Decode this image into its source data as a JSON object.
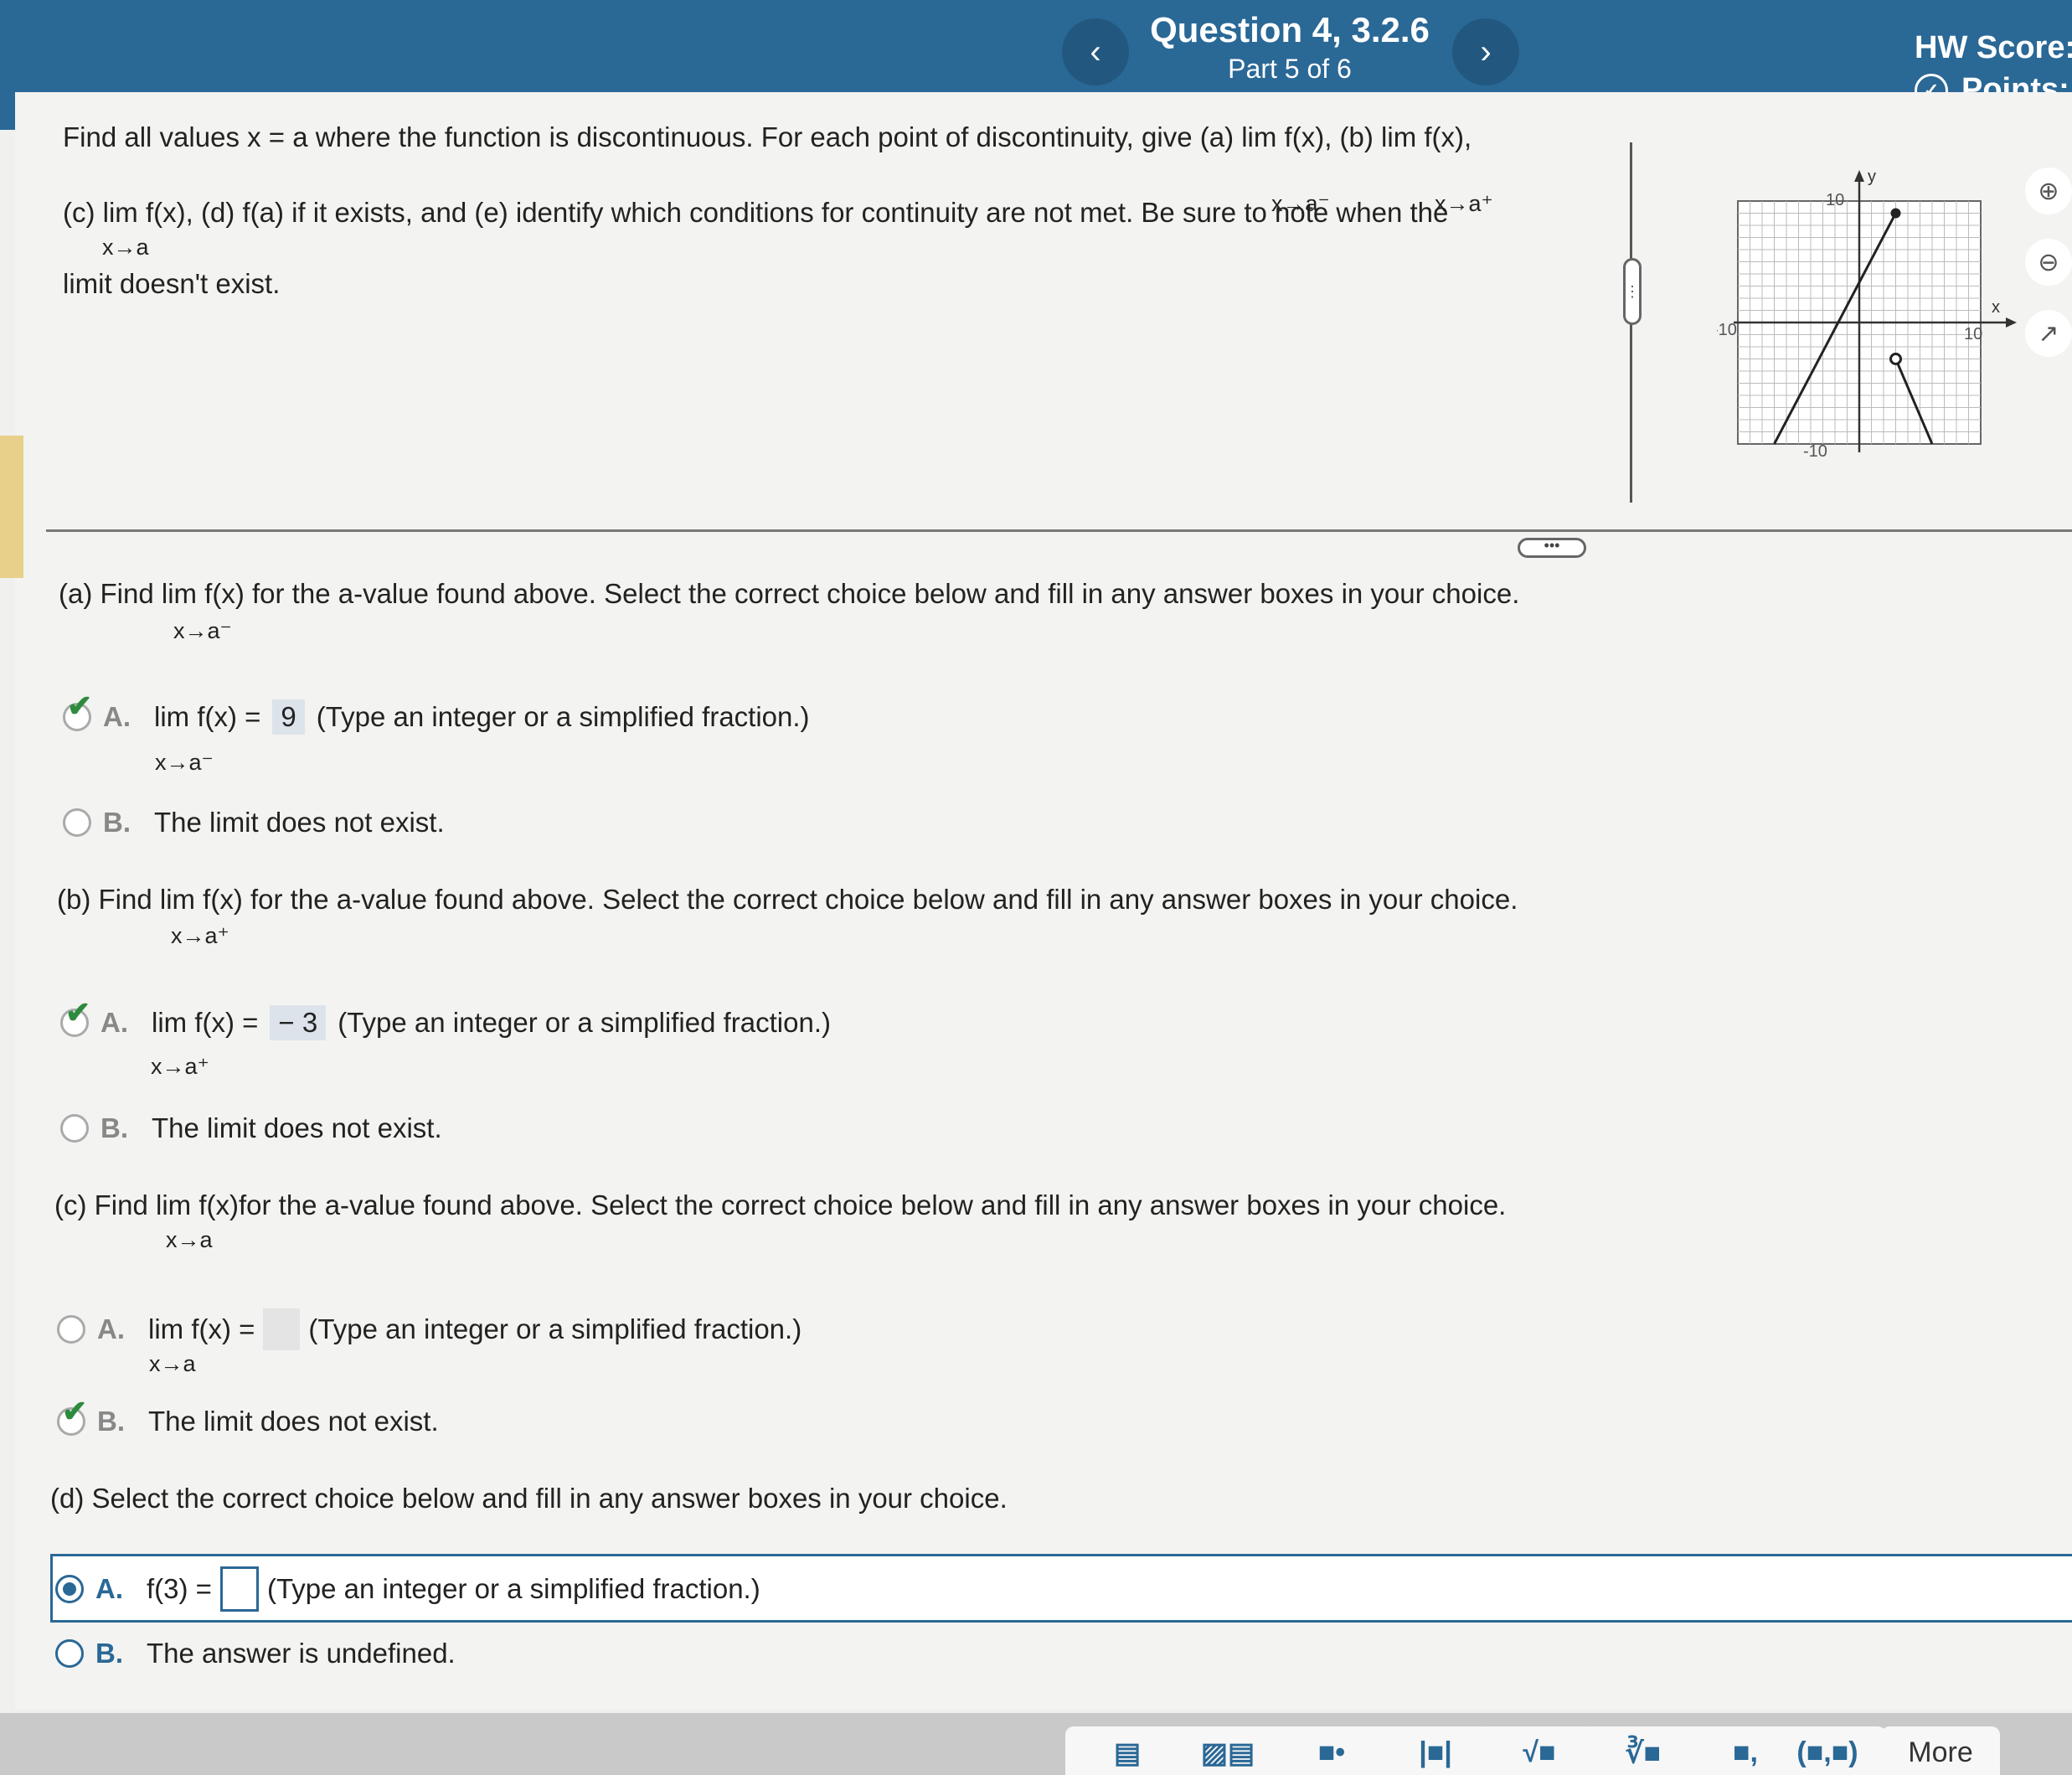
{
  "header": {
    "title": "Question 4, 3.2.6",
    "part": "Part 5 of 6",
    "hw_score_label": "HW Score:",
    "points_label": "Points:"
  },
  "problem": {
    "line1": "Find all values x = a where the function is discontinuous.  For each point of discontinuity, give (a)  lim   f(x), (b)  lim   f(x),",
    "sub1a": "x→a⁻",
    "sub1b": "x→a⁺",
    "line2": "(c)  lim  f(x), (d) f(a) if it exists, and (e) identify which conditions for continuity are not met.  Be sure to note when the",
    "sub2": "x→a",
    "line3": "limit doesn't exist."
  },
  "graph": {
    "y_label": "y",
    "x_label": "x",
    "tick_pos": "10",
    "tick_neg": "-10"
  },
  "part_a": {
    "prompt": "(a) Find  lim   f(x) for the a-value found above. Select the correct choice below and fill in any answer boxes in your choice.",
    "sub": "x→a⁻",
    "choice_a_letter": "A.",
    "choice_a_lim": "lim   f(x) =",
    "choice_a_sub": "x→a⁻",
    "choice_a_value": "9",
    "choice_a_hint": "(Type an integer or a simplified fraction.)",
    "choice_b_letter": "B.",
    "choice_b_text": "The limit does not exist."
  },
  "part_b": {
    "prompt": "(b) Find  lim   f(x) for the a-value found above. Select the correct choice below and fill in any answer boxes in your choice.",
    "sub": "x→a⁺",
    "choice_a_letter": "A.",
    "choice_a_lim": "lim   f(x) =",
    "choice_a_sub": "x→a⁺",
    "choice_a_value": "− 3",
    "choice_a_hint": "(Type an integer or a simplified fraction.)",
    "choice_b_letter": "B.",
    "choice_b_text": "The limit does not exist."
  },
  "part_c": {
    "prompt": "(c) Find  lim  f(x)for the a-value found above. Select the correct choice below and fill in any answer boxes in your choice.",
    "sub": "x→a",
    "choice_a_letter": "A.",
    "choice_a_lim": "lim  f(x) =",
    "choice_a_sub": "x→a",
    "choice_a_hint": "(Type an integer or a simplified fraction.)",
    "choice_b_letter": "B.",
    "choice_b_text": "The limit does not exist."
  },
  "part_d": {
    "prompt": "(d) Select the correct choice below and fill in any answer boxes in your choice.",
    "choice_a_letter": "A.",
    "choice_a_text": "f(3) =",
    "choice_a_hint": "(Type an integer or a simplified fraction.)",
    "choice_b_letter": "B.",
    "choice_b_text": "The answer is undefined."
  },
  "toolbar": {
    "more_label": "More",
    "buttons": [
      "fraction-icon",
      "mixed-number-icon",
      "exponent-icon",
      "absolute-value-icon",
      "sqrt-icon",
      "nth-root-icon",
      "subscript-icon",
      "ordered-pair-icon"
    ]
  },
  "colors": {
    "header": "#2a6896",
    "correct": "#2e8b3e",
    "accent": "#2a6896"
  }
}
